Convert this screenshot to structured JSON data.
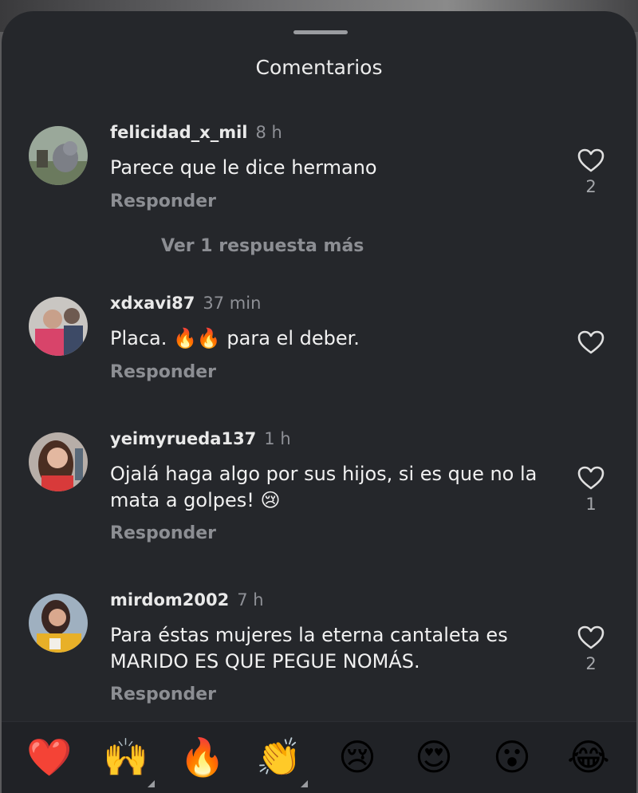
{
  "header": {
    "title": "Comentarios"
  },
  "comments": [
    {
      "user": "felicidad_x_mil",
      "time": "8 h",
      "text": "Parece que le dice hermano",
      "reply_label": "Responder",
      "likes": "2"
    },
    {
      "user": "xdxavi87",
      "time": "37 min",
      "text": "Placa. 🔥🔥 para el deber.",
      "reply_label": "Responder",
      "likes": ""
    },
    {
      "user": "yeimyrueda137",
      "time": "1 h",
      "text": "Ojalá haga algo por sus hijos, si es que no la mata a golpes! 😢",
      "reply_label": "Responder",
      "likes": "1"
    },
    {
      "user": "mirdom2002",
      "time": "7 h",
      "text": "Para éstas mujeres la eterna cantaleta es MARIDO ES QUE PEGUE NOMÁS.",
      "reply_label": "Responder",
      "likes": "2"
    }
  ],
  "more_replies_label": "Ver 1 respuesta más",
  "emoji_bar": [
    "❤️",
    "🙌",
    "🔥",
    "👏",
    "😢",
    "😍",
    "😮",
    "😂"
  ],
  "icons": {
    "like": "heart-outline-icon"
  },
  "colors": {
    "sheet": "#25272b",
    "muted_text": "#8c8e93",
    "primary_text": "#f1f1f1"
  }
}
